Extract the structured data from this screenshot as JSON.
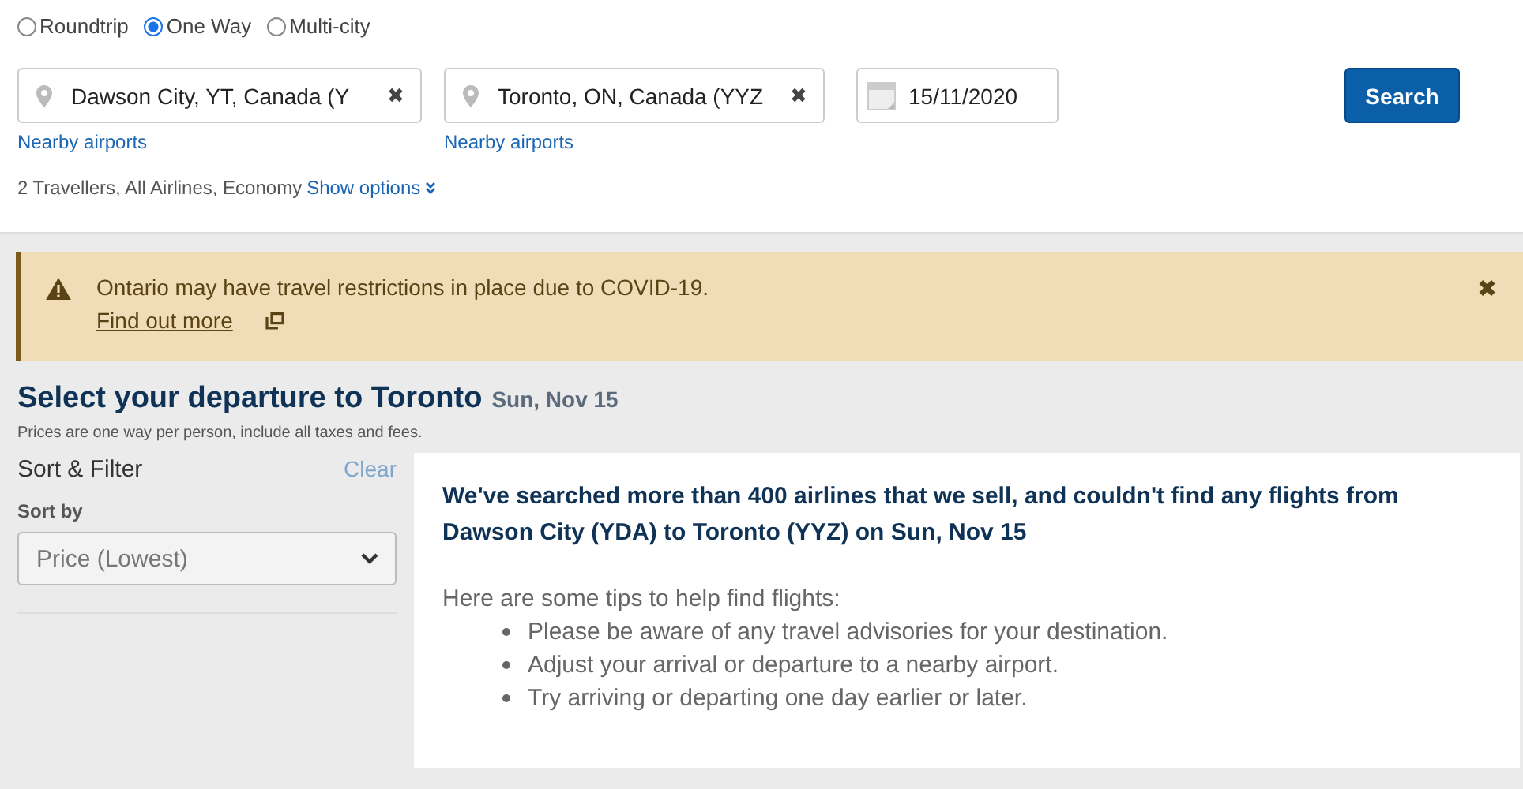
{
  "trip_types": [
    {
      "label": "Roundtrip",
      "selected": false
    },
    {
      "label": "One Way",
      "selected": true
    },
    {
      "label": "Multi-city",
      "selected": false
    }
  ],
  "origin": {
    "value": "Dawson City, YT, Canada (Y",
    "clear": "✖",
    "link": "Nearby airports"
  },
  "destination": {
    "value": "Toronto, ON, Canada (YYZ",
    "clear": "✖",
    "link": "Nearby airports"
  },
  "date": {
    "value": "15/11/2020"
  },
  "search_button": "Search",
  "travellers": "2 Travellers, All Airlines, Economy",
  "show_options": "Show options",
  "alert": {
    "message": "Ontario may have travel restrictions in place due to COVID-19.",
    "link": "Find out more",
    "close": "✖"
  },
  "heading": {
    "title": "Select your departure to Toronto",
    "date": "Sun, Nov 15",
    "note": "Prices are one way per person, include all taxes and fees."
  },
  "sidebar": {
    "title": "Sort & Filter",
    "clear": "Clear",
    "sort_label": "Sort by",
    "sort_value": "Price (Lowest)"
  },
  "results": {
    "message": "We've searched more than 400 airlines that we sell, and couldn't find any flights from Dawson City (YDA) to Toronto (YYZ) on Sun, Nov 15",
    "tips_intro": "Here are some tips to help find flights:",
    "tips": [
      "Please be aware of any travel advisories for your destination.",
      "Adjust your arrival or departure to a nearby airport.",
      "Try arriving or departing one day earlier or later."
    ]
  }
}
